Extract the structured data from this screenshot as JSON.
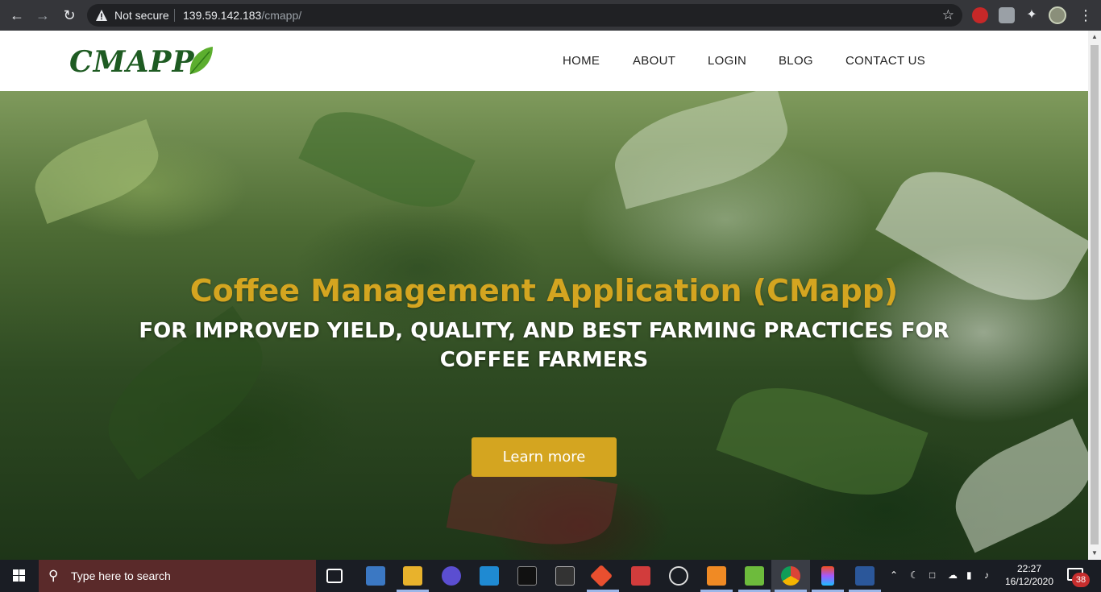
{
  "browser": {
    "security_label": "Not secure",
    "url_host": "139.59.142.183",
    "url_path": "/cmapp/"
  },
  "site": {
    "logo_text": "CMAPP",
    "nav": [
      "HOME",
      "ABOUT",
      "LOGIN",
      "BLOG",
      "CONTACT US"
    ]
  },
  "hero": {
    "title": "Coffee Management Application (CMapp)",
    "subtitle": "FOR IMPROVED YIELD, QUALITY, AND BEST FARMING PRACTICES FOR COFFEE FARMERS",
    "button_label": "Learn more",
    "accent_color": "#d4a520"
  },
  "taskbar": {
    "search_placeholder": "Type here to search",
    "time": "22:27",
    "date": "16/12/2020",
    "notification_count": "38",
    "pinned": [
      "task-view-icon",
      "app-icon",
      "file-explorer-icon",
      "browser-icon",
      "vscode-icon",
      "terminal-icon",
      "console-icon",
      "git-icon",
      "arduino-icon",
      "app-icon",
      "sublime-icon",
      "bluestacks-icon",
      "chrome-icon",
      "figma-icon",
      "word-icon"
    ]
  }
}
